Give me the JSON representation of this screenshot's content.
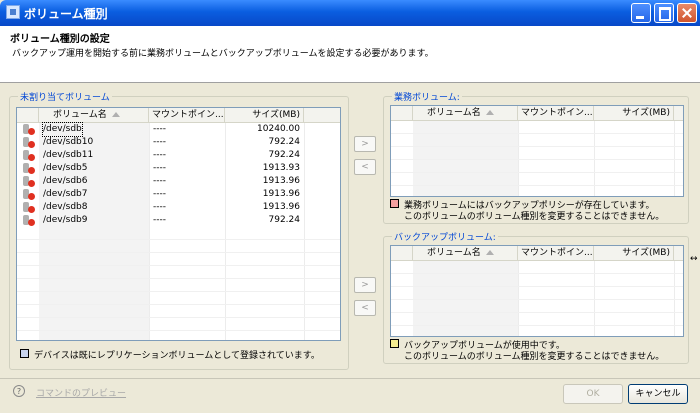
{
  "window": {
    "title": "ボリューム種別"
  },
  "header": {
    "title": "ボリューム種別の設定",
    "description": "バックアップ運用を開始する前に業務ボリュームとバックアップボリュームを設定する必要があります。"
  },
  "unassigned": {
    "label": "未割り当てボリューム",
    "columns": {
      "name": "ボリューム名",
      "mount": "マウントポイン...",
      "size": "サイズ(MB)"
    },
    "rows": [
      {
        "name": "/dev/sdb",
        "mount": "----",
        "size": "10240.00"
      },
      {
        "name": "/dev/sdb10",
        "mount": "----",
        "size": "792.24"
      },
      {
        "name": "/dev/sdb11",
        "mount": "----",
        "size": "792.24"
      },
      {
        "name": "/dev/sdb5",
        "mount": "----",
        "size": "1913.93"
      },
      {
        "name": "/dev/sdb6",
        "mount": "----",
        "size": "1913.96"
      },
      {
        "name": "/dev/sdb7",
        "mount": "----",
        "size": "1913.96"
      },
      {
        "name": "/dev/sdb8",
        "mount": "----",
        "size": "1913.96"
      },
      {
        "name": "/dev/sdb9",
        "mount": "----",
        "size": "792.24"
      }
    ],
    "legend": "デバイスは既にレプリケーションボリュームとして登録されています。",
    "legend_color": "#c8d4ee"
  },
  "business": {
    "label": "業務ボリューム:",
    "columns": {
      "name": "ボリューム名",
      "mount": "マウントポイン...",
      "size": "サイズ(MB)"
    },
    "legend_line1": "業務ボリュームにはバックアップポリシーが存在しています。",
    "legend_line2": "このボリュームのボリューム種別を変更することはできません。",
    "legend_color": "#f4a0a0"
  },
  "backup": {
    "label": "バックアップボリューム:",
    "columns": {
      "name": "ボリューム名",
      "mount": "マウントポイン...",
      "size": "サイズ(MB)"
    },
    "legend_line1": "バックアップボリュームが使用中です。",
    "legend_line2": "このボリュームのボリューム種別を変更することはできません。",
    "legend_color": "#f4ec90"
  },
  "arrows": {
    "right": ">",
    "left": "<"
  },
  "footer": {
    "help": "?",
    "preview": "コマンドのプレビュー",
    "ok": "OK",
    "cancel": "キャンセル"
  },
  "icons": {
    "volume": "disk-volume-icon"
  }
}
